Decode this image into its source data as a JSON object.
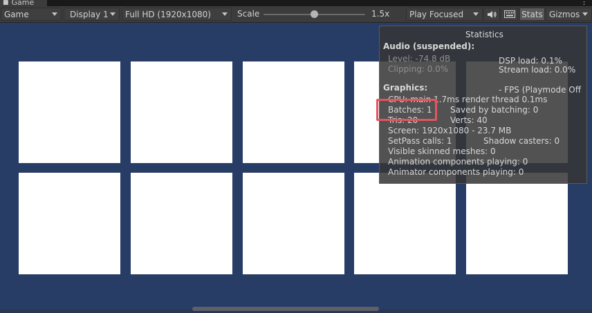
{
  "window": {
    "tab_title": "Game",
    "tab_icon": "gamepad-icon",
    "more_icon": "kebab-menu-icon"
  },
  "toolbar": {
    "view_select": "Game",
    "display_select": "Display 1",
    "resolution_select": "Full HD (1920x1080)",
    "scale_label": "Scale",
    "scale_value": "1.5x",
    "scale_slider_fraction": 0.5,
    "play_mode_select": "Play Focused",
    "audio_icon": "speaker-icon",
    "keyboard_icon": "keyboard-icon",
    "stats_label": "Stats",
    "gizmos_label": "Gizmos"
  },
  "colors": {
    "game_background": "#283d66",
    "square_color": "#ffffff",
    "highlight_color": "#e4555e"
  },
  "stats": {
    "title": "Statistics",
    "audio_header": "Audio (suspended):",
    "level": "Level: -74.8 dB",
    "clipping": "Clipping: 0.0%",
    "dsp_load": "DSP load: 0.1%",
    "stream_load": "Stream load: 0.0%",
    "graphics_header": "Graphics:",
    "fps": "- FPS (Playmode Off",
    "cpu": "CPU: main 1.7ms  render thread 0.1ms",
    "batches": "Batches: 1",
    "saved_by_batching": "Saved by batching: 0",
    "tris": "Tris: 20",
    "verts": "Verts: 40",
    "screen": "Screen: 1920x1080 - 23.7 MB",
    "setpass": "SetPass calls: 1",
    "shadow_casters": "Shadow casters: 0",
    "visible_skinned": "Visible skinned meshes: 0",
    "animation_components": "Animation components playing: 0",
    "animator_components": "Animator components playing: 0"
  }
}
